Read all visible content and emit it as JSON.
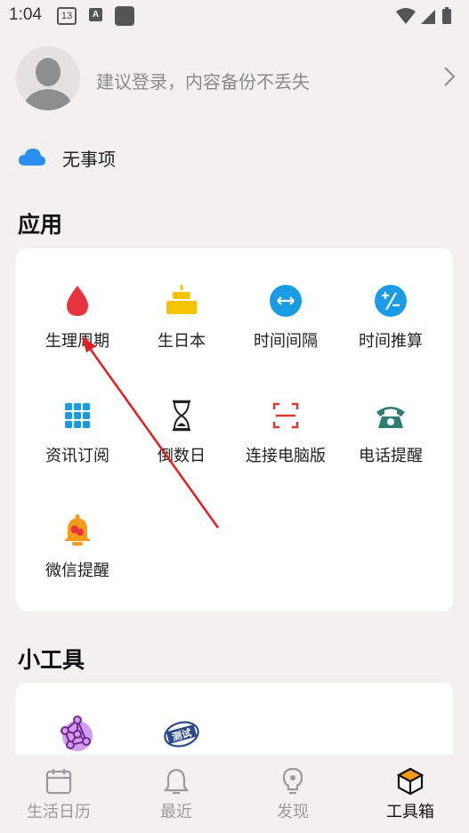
{
  "status_bar": {
    "time": "1:04",
    "calendar_day": "13",
    "a_glyph": "A"
  },
  "login": {
    "prompt": "建议登录，内容备份不丢失"
  },
  "todo": {
    "text": "无事项"
  },
  "apps_section": {
    "title": "应用",
    "items": [
      {
        "label": "生理周期",
        "icon": "blood-drop-icon",
        "color": "#e8343f"
      },
      {
        "label": "生日本",
        "icon": "birthday-cake-icon",
        "color": "#f5c400"
      },
      {
        "label": "时间间隔",
        "icon": "interval-arrows-icon",
        "color": "#1a9be6"
      },
      {
        "label": "时间推算",
        "icon": "plus-minus-icon",
        "color": "#1a9be6"
      },
      {
        "label": "资讯订阅",
        "icon": "grid-icon",
        "color": "#1a9be6"
      },
      {
        "label": "倒数日",
        "icon": "hourglass-icon",
        "color": "#222222"
      },
      {
        "label": "连接电脑版",
        "icon": "scan-frame-icon",
        "color": "#d93a2b"
      },
      {
        "label": "电话提醒",
        "icon": "telephone-icon",
        "color": "#2e7d74"
      },
      {
        "label": "微信提醒",
        "icon": "bell-icon",
        "color": "#f39a16"
      }
    ]
  },
  "tools_section": {
    "title": "小工具",
    "items": [
      {
        "icon": "molecule-icon",
        "color": "#b85ee0"
      },
      {
        "icon": "test-stamp-icon",
        "stamp_text": "测试",
        "color": "#2b4a8a"
      }
    ]
  },
  "bottom_nav": {
    "items": [
      {
        "label": "生活日历",
        "icon": "calendar-icon",
        "active": false
      },
      {
        "label": "最近",
        "icon": "bell-icon",
        "active": false
      },
      {
        "label": "发现",
        "icon": "lightbulb-icon",
        "active": false
      },
      {
        "label": "工具箱",
        "icon": "box-icon",
        "active": true
      }
    ]
  },
  "colors": {
    "background": "#f3f1f0",
    "card": "#ffffff",
    "accent_blue": "#1a9be6",
    "arrow_red": "#e02020"
  }
}
